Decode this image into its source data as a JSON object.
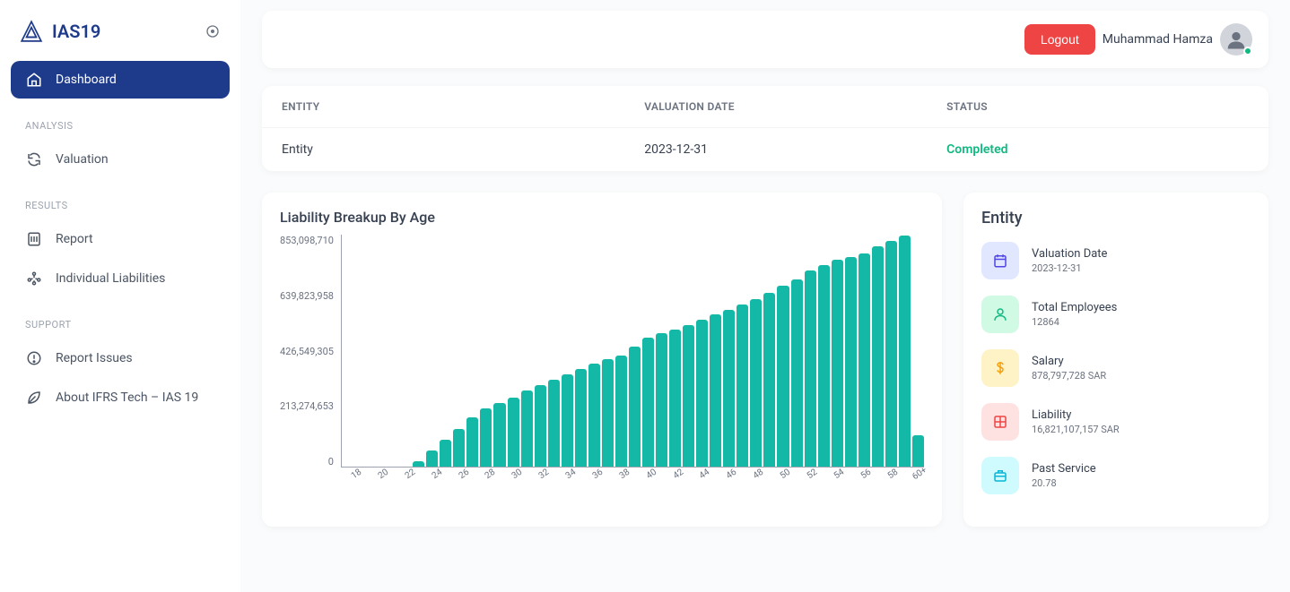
{
  "app_name": "IAS19",
  "user": {
    "name": "Muhammad Hamza"
  },
  "header": {
    "logout_label": "Logout"
  },
  "sidebar": {
    "items": [
      {
        "key": "dashboard",
        "label": "Dashboard"
      }
    ],
    "sections": [
      {
        "title": "ANALYSIS",
        "items": [
          {
            "key": "valuation",
            "label": "Valuation"
          }
        ]
      },
      {
        "title": "RESULTS",
        "items": [
          {
            "key": "report",
            "label": "Report"
          },
          {
            "key": "individual-liabilities",
            "label": "Individual Liabilities"
          }
        ]
      },
      {
        "title": "SUPPORT",
        "items": [
          {
            "key": "report-issues",
            "label": "Report Issues"
          },
          {
            "key": "about",
            "label": "About IFRS Tech – IAS 19"
          }
        ]
      }
    ]
  },
  "summary_table": {
    "headers": [
      "ENTITY",
      "VALUATION DATE",
      "STATUS"
    ],
    "rows": [
      {
        "entity": "Entity",
        "valuation_date": "2023-12-31",
        "status": "Completed"
      }
    ]
  },
  "chart_data": {
    "type": "bar",
    "title": "Liability Breakup By Age",
    "categories": [
      "18",
      "19",
      "20",
      "21",
      "22",
      "23",
      "24",
      "25",
      "26",
      "27",
      "28",
      "29",
      "30",
      "31",
      "32",
      "33",
      "34",
      "35",
      "36",
      "37",
      "38",
      "39",
      "40",
      "41",
      "42",
      "43",
      "44",
      "45",
      "46",
      "47",
      "48",
      "49",
      "50",
      "51",
      "52",
      "53",
      "54",
      "55",
      "56",
      "57",
      "58",
      "59",
      "60+"
    ],
    "x_tick_labels_visible": [
      "18",
      "20",
      "22",
      "24",
      "26",
      "28",
      "30",
      "32",
      "34",
      "36",
      "38",
      "40",
      "42",
      "44",
      "46",
      "48",
      "50",
      "52",
      "54",
      "56",
      "58",
      "60+"
    ],
    "values": [
      0,
      0,
      0,
      0,
      0,
      20000000,
      60000000,
      100000000,
      140000000,
      180000000,
      215000000,
      235000000,
      255000000,
      280000000,
      300000000,
      320000000,
      340000000,
      360000000,
      380000000,
      395000000,
      410000000,
      440000000,
      475000000,
      490000000,
      505000000,
      520000000,
      540000000,
      560000000,
      575000000,
      595000000,
      615000000,
      640000000,
      665000000,
      690000000,
      720000000,
      740000000,
      760000000,
      770000000,
      785000000,
      810000000,
      830000000,
      850000000,
      115000000
    ],
    "y_ticks": [
      "853,098,710",
      "639,823,958",
      "426,549,305",
      "213,274,653",
      "0"
    ],
    "ylim": [
      0,
      853098710
    ],
    "xlabel": "",
    "ylabel": ""
  },
  "entity_panel": {
    "title": "Entity",
    "metrics": [
      {
        "key": "valuation-date",
        "icon": "calendar-icon",
        "label": "Valuation Date",
        "value": "2023-12-31",
        "color": "blue"
      },
      {
        "key": "total-employees",
        "icon": "person-icon",
        "label": "Total Employees",
        "value": "12864",
        "color": "green"
      },
      {
        "key": "salary",
        "icon": "dollar-icon",
        "label": "Salary",
        "value": "878,797,728 SAR",
        "color": "orange"
      },
      {
        "key": "liability",
        "icon": "grid-icon",
        "label": "Liability",
        "value": "16,821,107,157 SAR",
        "color": "red"
      },
      {
        "key": "past-service",
        "icon": "briefcase-icon",
        "label": "Past Service",
        "value": "20.78",
        "color": "cyan"
      }
    ]
  }
}
